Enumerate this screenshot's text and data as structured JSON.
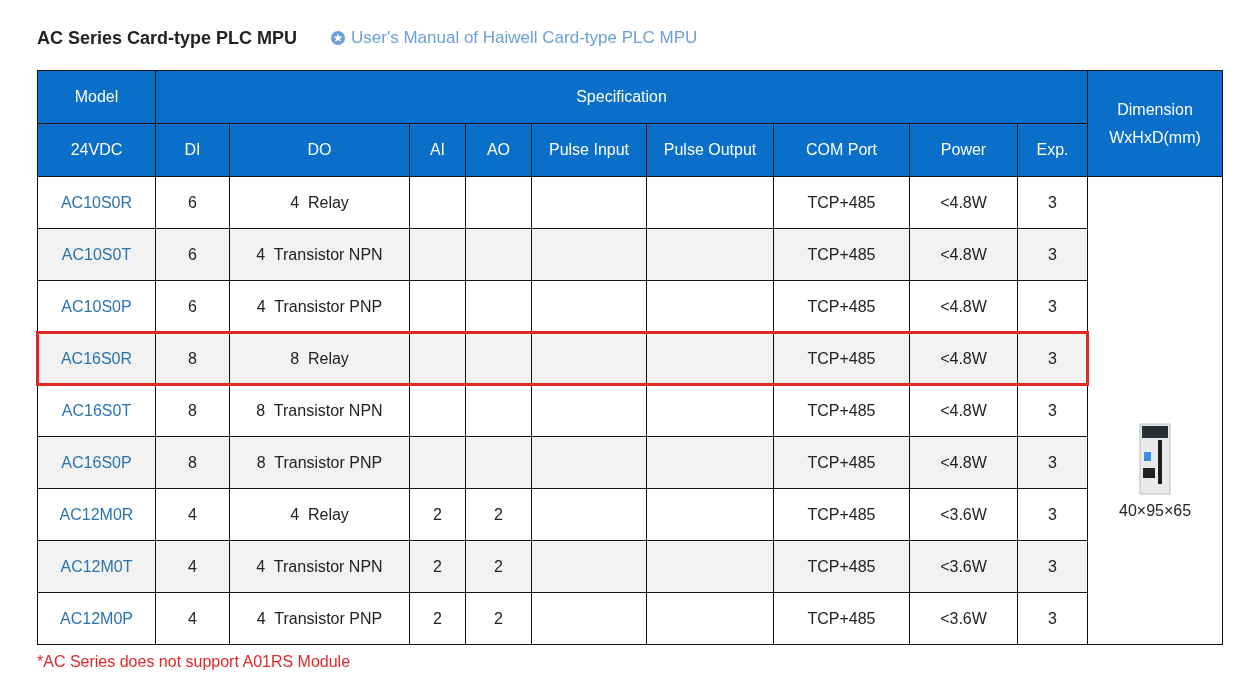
{
  "title": "AC Series Card-type PLC MPU",
  "manual_link": "User's Manual of Haiwell Card-type PLC MPU",
  "table": {
    "group_headers": [
      "Model",
      "Specification",
      "Dimension WxHxD(mm)"
    ],
    "columns": [
      "24VDC",
      "DI",
      "DO",
      "AI",
      "AO",
      "Pulse Input",
      "Pulse Output",
      "COM Port",
      "Power",
      "Exp."
    ],
    "rows": [
      {
        "cells": [
          "AC10S0R",
          "6",
          "4  Relay",
          null,
          null,
          null,
          null,
          "TCP+485",
          "<4.8W",
          "3"
        ],
        "highlighted": false
      },
      {
        "cells": [
          "AC10S0T",
          "6",
          "4  Transistor NPN",
          null,
          null,
          null,
          null,
          "TCP+485",
          "<4.8W",
          "3"
        ],
        "highlighted": false
      },
      {
        "cells": [
          "AC10S0P",
          "6",
          "4  Transistor PNP",
          null,
          null,
          null,
          null,
          "TCP+485",
          "<4.8W",
          "3"
        ],
        "highlighted": false
      },
      {
        "cells": [
          "AC16S0R",
          "8",
          "8  Relay",
          null,
          null,
          null,
          null,
          "TCP+485",
          "<4.8W",
          "3"
        ],
        "highlighted": true
      },
      {
        "cells": [
          "AC16S0T",
          "8",
          "8  Transistor NPN",
          null,
          null,
          null,
          null,
          "TCP+485",
          "<4.8W",
          "3"
        ],
        "highlighted": false
      },
      {
        "cells": [
          "AC16S0P",
          "8",
          "8  Transistor PNP",
          null,
          null,
          null,
          null,
          "TCP+485",
          "<4.8W",
          "3"
        ],
        "highlighted": false
      },
      {
        "cells": [
          "AC12M0R",
          "4",
          "4  Relay",
          "2",
          "2",
          null,
          null,
          "TCP+485",
          "<3.6W",
          "3"
        ],
        "highlighted": false
      },
      {
        "cells": [
          "AC12M0T",
          "4",
          "4  Transistor NPN",
          "2",
          "2",
          null,
          null,
          "TCP+485",
          "<3.6W",
          "3"
        ],
        "highlighted": false
      },
      {
        "cells": [
          "AC12M0P",
          "4",
          "4  Transistor PNP",
          "2",
          "2",
          null,
          null,
          "TCP+485",
          "<3.6W",
          "3"
        ],
        "highlighted": false
      }
    ],
    "dimension": "40×95×65"
  },
  "note": "*AC Series does not support A01RS Module"
}
